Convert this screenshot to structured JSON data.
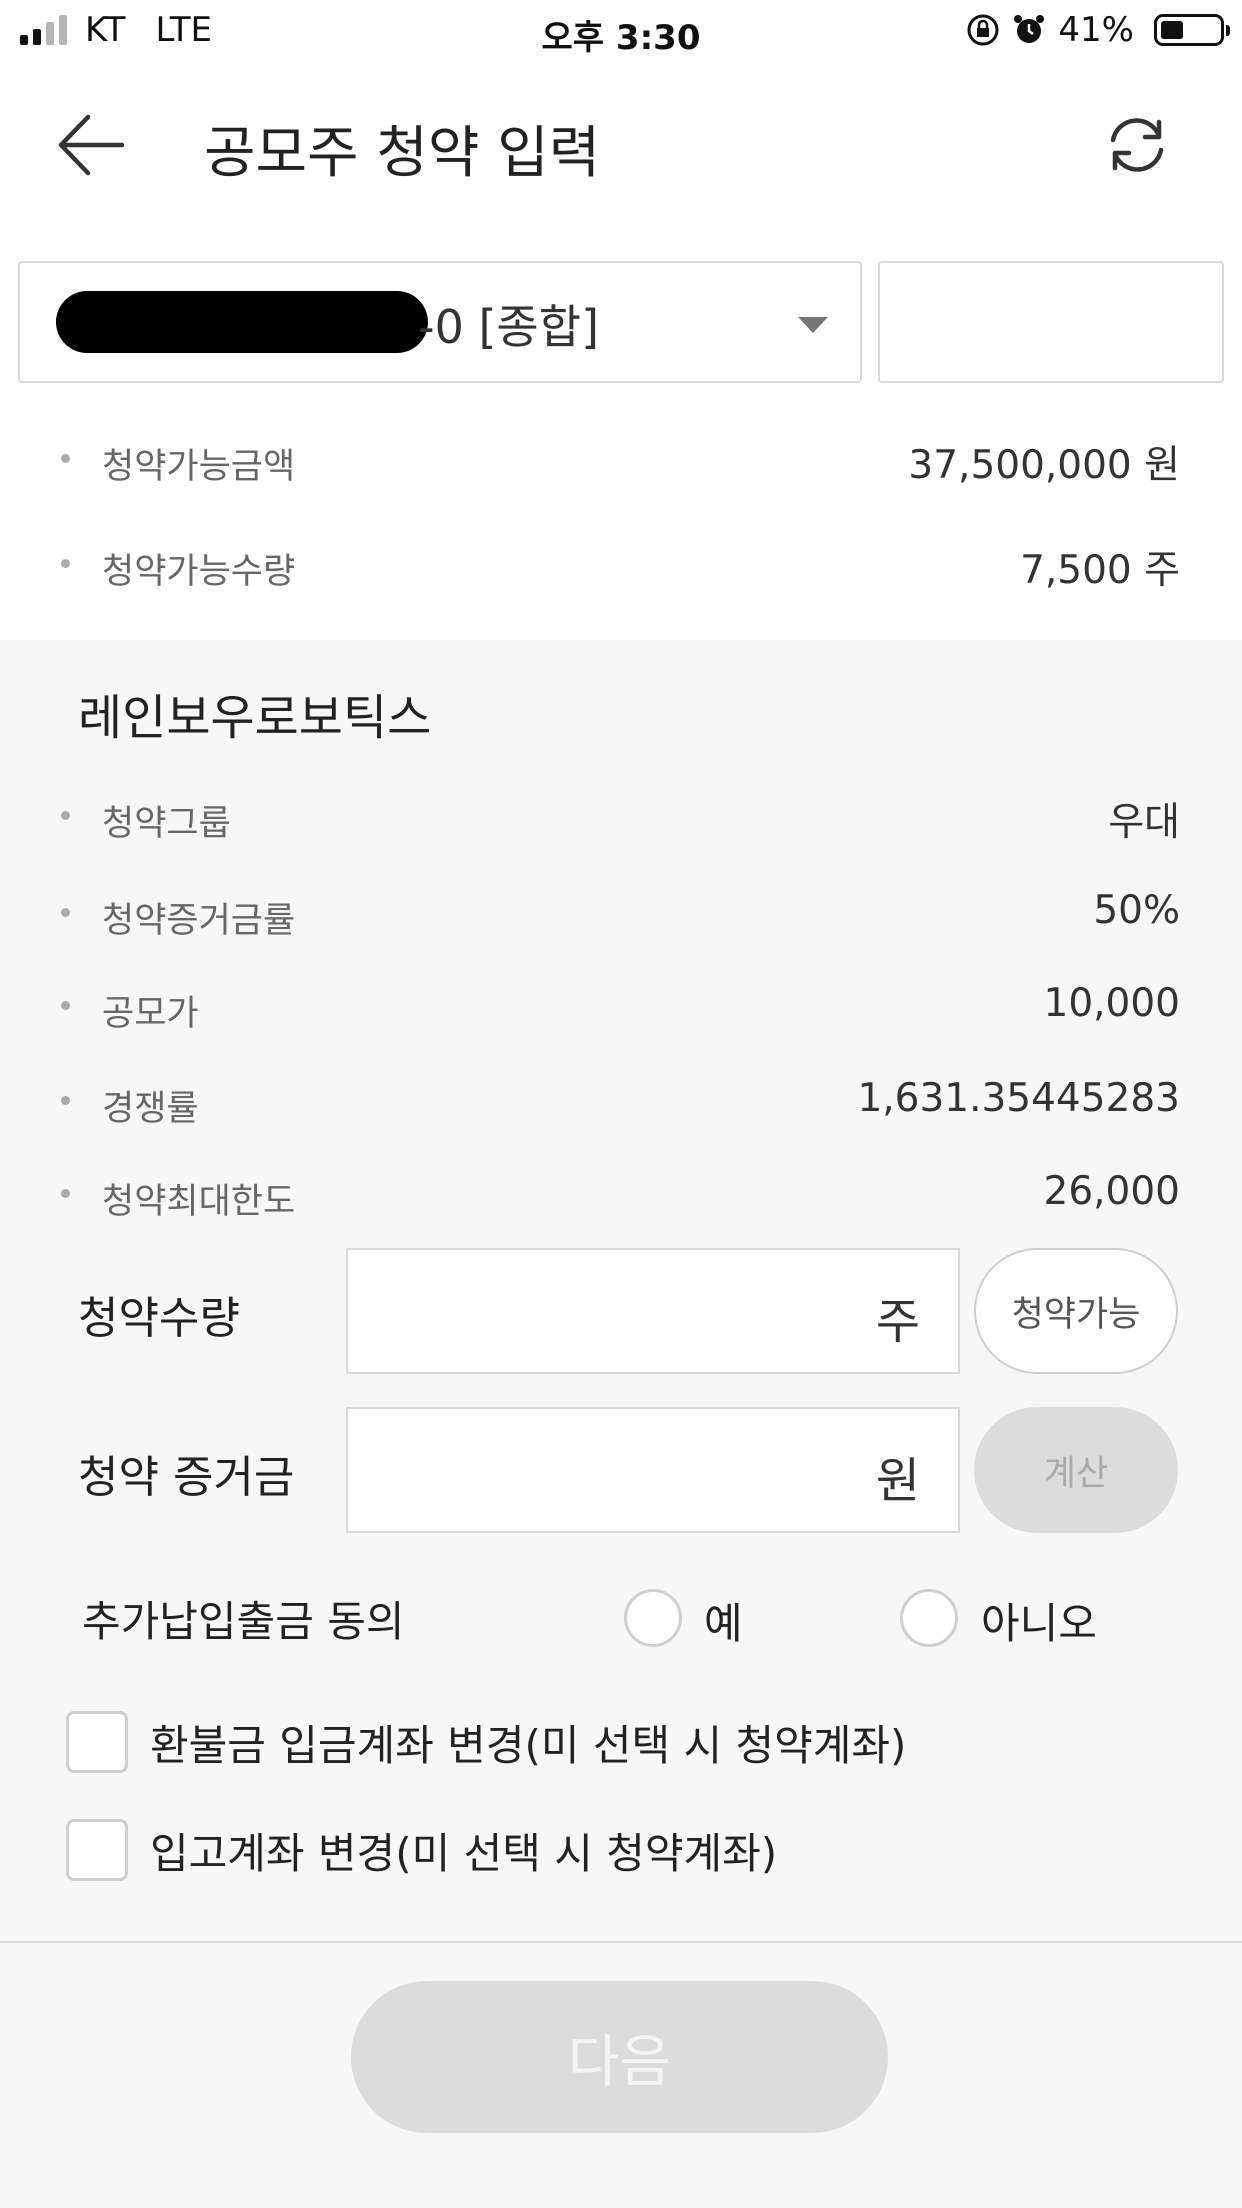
{
  "status_bar": {
    "carrier": "KT",
    "network": "LTE",
    "time": "오후 3:30",
    "battery": "41%",
    "icons": [
      "signal-icon",
      "orientation-lock-icon",
      "alarm-icon",
      "battery-icon"
    ]
  },
  "header": {
    "title": "공모주 청약 입력",
    "back_icon": "arrow-left-icon",
    "refresh_icon": "refresh-icon"
  },
  "account": {
    "selected_suffix": "-0 [종합]",
    "extra_field_value": ""
  },
  "availability": [
    {
      "label": "청약가능금액",
      "value": "37,500,000 원"
    },
    {
      "label": "청약가능수량",
      "value": "7,500 주"
    }
  ],
  "stock": {
    "name": "레인보우로보틱스",
    "details": [
      {
        "label": "청약그룹",
        "value": "우대"
      },
      {
        "label": "청약증거금률",
        "value": "50%"
      },
      {
        "label": "공모가",
        "value": "10,000"
      },
      {
        "label": "경쟁률",
        "value": "1,631.35445283"
      },
      {
        "label": "청약최대한도",
        "value": "26,000"
      }
    ]
  },
  "form": {
    "quantity": {
      "label": "청약수량",
      "value": "",
      "unit": "주",
      "button": "청약가능"
    },
    "deposit": {
      "label": "청약 증거금",
      "value": "",
      "unit": "원",
      "button": "계산"
    },
    "consent": {
      "label": "추가납입출금 동의",
      "yes": "예",
      "no": "아니오"
    },
    "checkboxes": [
      {
        "label": "환불금 입금계좌 변경(미 선택 시 청약계좌)"
      },
      {
        "label": "입고계좌 변경(미 선택 시 청약계좌)"
      }
    ]
  },
  "footer": {
    "next_label": "다음"
  }
}
